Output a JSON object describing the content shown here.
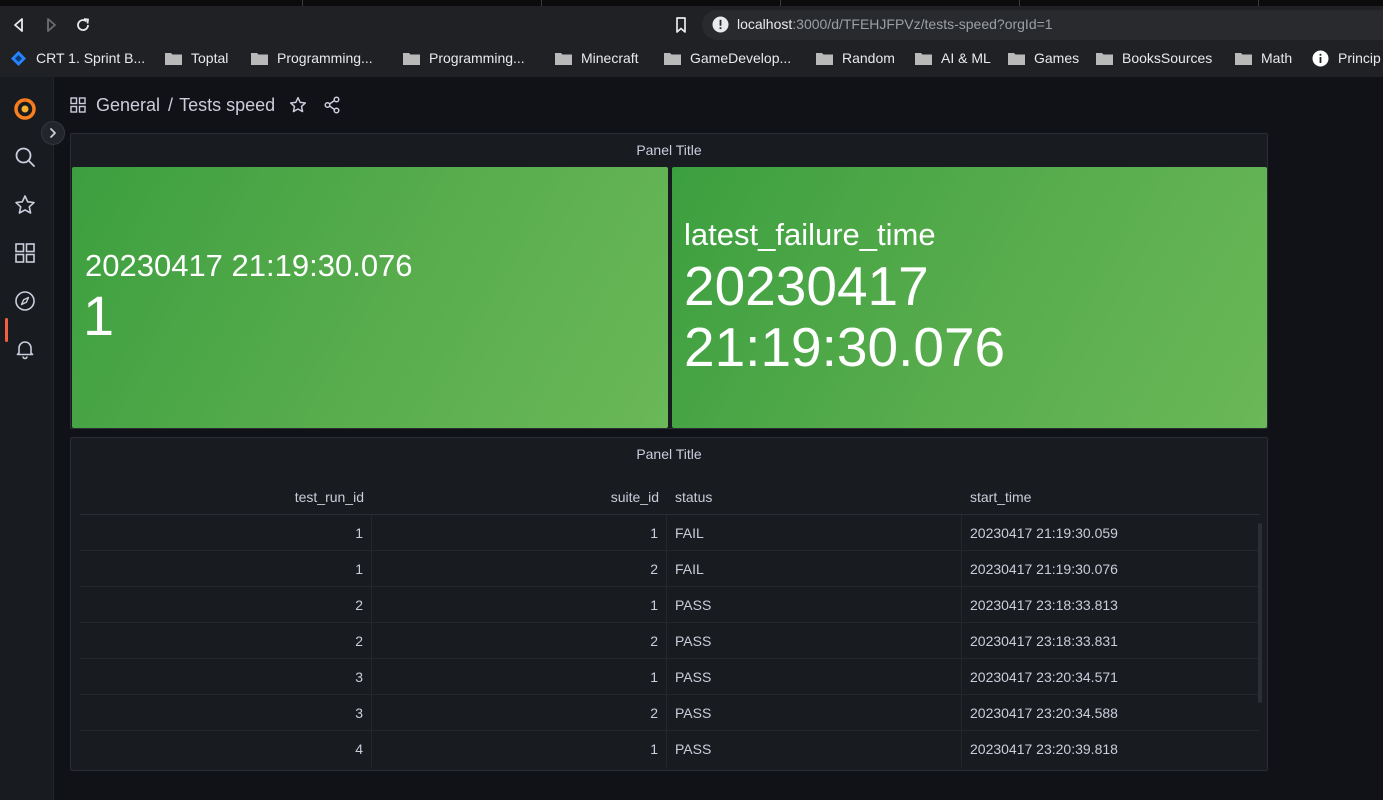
{
  "browser": {
    "url_host": "localhost",
    "url_rest": ":3000/d/TFEHJFPVz/tests-speed?orgId=1",
    "bookmarks": [
      {
        "label": "CRT 1. Sprint B...",
        "icon": "jira-icon"
      },
      {
        "label": "Toptal",
        "icon": "folder-icon"
      },
      {
        "label": "Programming...",
        "icon": "folder-icon"
      },
      {
        "label": "Programming...",
        "icon": "folder-icon"
      },
      {
        "label": "Minecraft",
        "icon": "folder-icon"
      },
      {
        "label": "GameDevelop...",
        "icon": "folder-icon"
      },
      {
        "label": "Random",
        "icon": "folder-icon"
      },
      {
        "label": "AI & ML",
        "icon": "folder-icon"
      },
      {
        "label": "Games",
        "icon": "folder-icon"
      },
      {
        "label": "BooksSources",
        "icon": "folder-icon"
      },
      {
        "label": "Math",
        "icon": "folder-icon"
      },
      {
        "label": "Princip",
        "icon": "info-icon"
      }
    ]
  },
  "header": {
    "folder": "General",
    "separator": "/",
    "dashboard": "Tests speed"
  },
  "stat_panel": {
    "title": "Panel Title",
    "stat_a": {
      "title": "20230417 21:19:30.076",
      "value": "1"
    },
    "stat_b": {
      "title": "latest_failure_time",
      "value_line1": "20230417",
      "value_line2": "21:19:30.076"
    },
    "color": "#56a64b"
  },
  "table_panel": {
    "title": "Panel Title",
    "columns": [
      "test_run_id",
      "suite_id",
      "status",
      "start_time"
    ],
    "rows": [
      [
        "1",
        "1",
        "FAIL",
        "20230417 21:19:30.059"
      ],
      [
        "1",
        "2",
        "FAIL",
        "20230417 21:19:30.076"
      ],
      [
        "2",
        "1",
        "PASS",
        "20230417 23:18:33.813"
      ],
      [
        "2",
        "2",
        "PASS",
        "20230417 23:18:33.831"
      ],
      [
        "3",
        "1",
        "PASS",
        "20230417 23:20:34.571"
      ],
      [
        "3",
        "2",
        "PASS",
        "20230417 23:20:34.588"
      ],
      [
        "4",
        "1",
        "PASS",
        "20230417 23:20:39.818"
      ]
    ]
  }
}
